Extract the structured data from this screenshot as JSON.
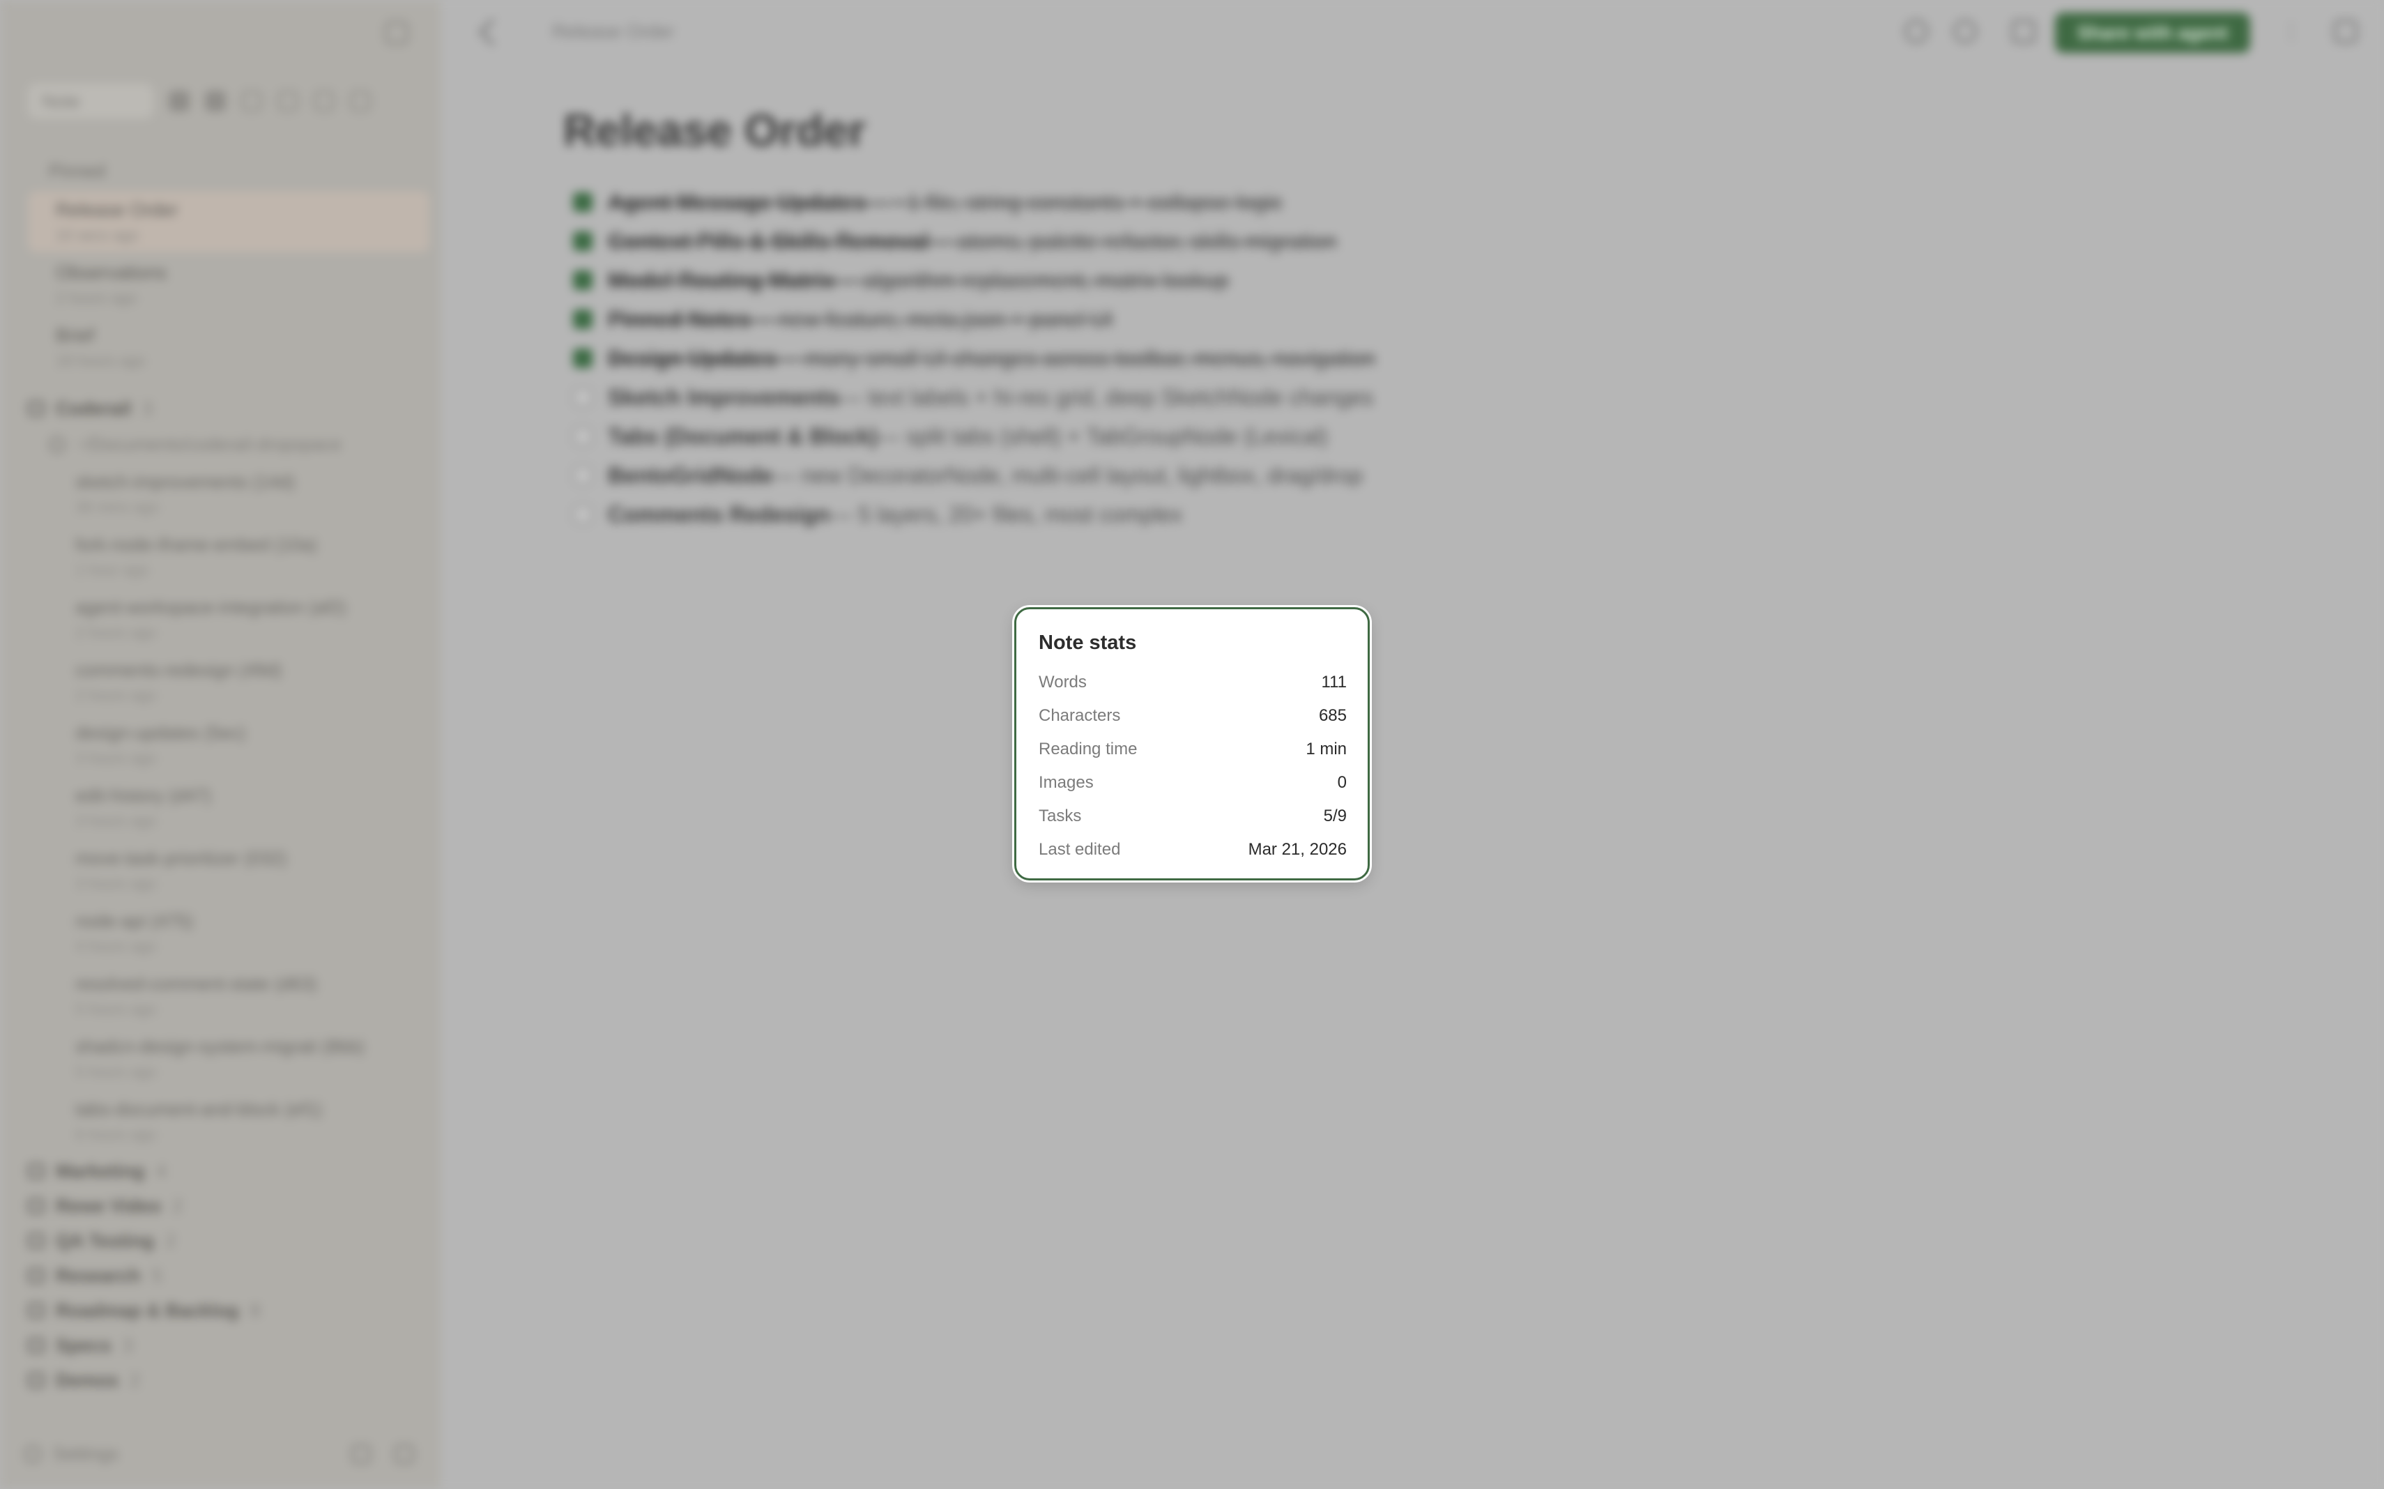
{
  "sidebar": {
    "search_placeholder": "Note",
    "section_label": "Pinned",
    "pinned": [
      {
        "title": "Release Order",
        "subtitle": "10 secs ago"
      },
      {
        "title": "Observations",
        "subtitle": "2 hours ago"
      },
      {
        "title": "Brief",
        "subtitle": "18 hours ago"
      }
    ],
    "folder_open": {
      "name": "Coderail",
      "count": "3"
    },
    "branch": "~/Documents/coderail-dropspace",
    "workspace_items": [
      {
        "title": "sketch-improvements (14d)",
        "subtitle": "38 mins ago"
      },
      {
        "title": "fork-node-iframe-embed (10a)",
        "subtitle": "1 hour ago"
      },
      {
        "title": "agent-workspace-integration (af2)",
        "subtitle": "2 hours ago"
      },
      {
        "title": "comments-redesign (49d)",
        "subtitle": "2 hours ago"
      },
      {
        "title": "design-updates (5ec)",
        "subtitle": "3 hours ago"
      },
      {
        "title": "edit-history (d47)",
        "subtitle": "3 hours ago"
      },
      {
        "title": "move-task-prioritizer (032)",
        "subtitle": "3 hours ago"
      },
      {
        "title": "node-api (475)",
        "subtitle": "4 hours ago"
      },
      {
        "title": "resolved-comment-state (d63)",
        "subtitle": "5 hours ago"
      },
      {
        "title": "shadcn-design-system-migrati (8bb)",
        "subtitle": "5 hours ago"
      },
      {
        "title": "tabs-document-and-block (ef1)",
        "subtitle": "6 hours ago"
      }
    ],
    "folders": [
      {
        "name": "Marketing",
        "count": "4"
      },
      {
        "name": "Rewe Video",
        "count": "2"
      },
      {
        "name": "QA Testing",
        "count": "2"
      },
      {
        "name": "Research",
        "count": "5"
      },
      {
        "name": "Roadmap & Backlog",
        "count": "8"
      },
      {
        "name": "Specs",
        "count": "3"
      },
      {
        "name": "Demos",
        "count": "2"
      }
    ],
    "settings_label": "Settings"
  },
  "topbar": {
    "breadcrumb": "Release Order",
    "share_label": "Share with agent"
  },
  "document": {
    "title": "Release Order",
    "tasks": [
      {
        "done": true,
        "bold": "Agent Message Updates",
        "rest": " — ~1 file, string constants + collapse logic"
      },
      {
        "done": true,
        "bold": "Context Pills & Skills Removal",
        "rest": " — atoms, palette refactor, skills migration"
      },
      {
        "done": true,
        "bold": "Model Routing Matrix",
        "rest": " — algorithm replacement, matrix lookup"
      },
      {
        "done": true,
        "bold": "Pinned Notes",
        "rest": " — new feature, meta.json + panel UI"
      },
      {
        "done": true,
        "bold": "Design Updates",
        "rest": " — many small UI changes across toolbar, menus, navigation"
      },
      {
        "done": false,
        "bold": "Sketch Improvements",
        "rest": " — text labels + hi-res grid, deep SketchNode changes"
      },
      {
        "done": false,
        "bold": "Tabs (Document & Block)",
        "rest": " — split tabs (shell) + TabGroupNode (Lexical)"
      },
      {
        "done": false,
        "bold": "BentoGridNode",
        "rest": " — new DecoratorNode, multi-cell layout, lightbox, drag/drop"
      },
      {
        "done": false,
        "bold": "Comments Redesign",
        "rest": " — 5 layers, 20+ files, most complex"
      }
    ]
  },
  "stats": {
    "title": "Note stats",
    "rows": [
      {
        "label": "Words",
        "value": "111"
      },
      {
        "label": "Characters",
        "value": "685"
      },
      {
        "label": "Reading time",
        "value": "1 min"
      },
      {
        "label": "Images",
        "value": "0"
      },
      {
        "label": "Tasks",
        "value": "5/9"
      },
      {
        "label": "Last edited",
        "value": "Mar 21, 2026"
      }
    ]
  },
  "colors": {
    "accent": "#3f6a43",
    "overlay": "#b6b6b6"
  }
}
